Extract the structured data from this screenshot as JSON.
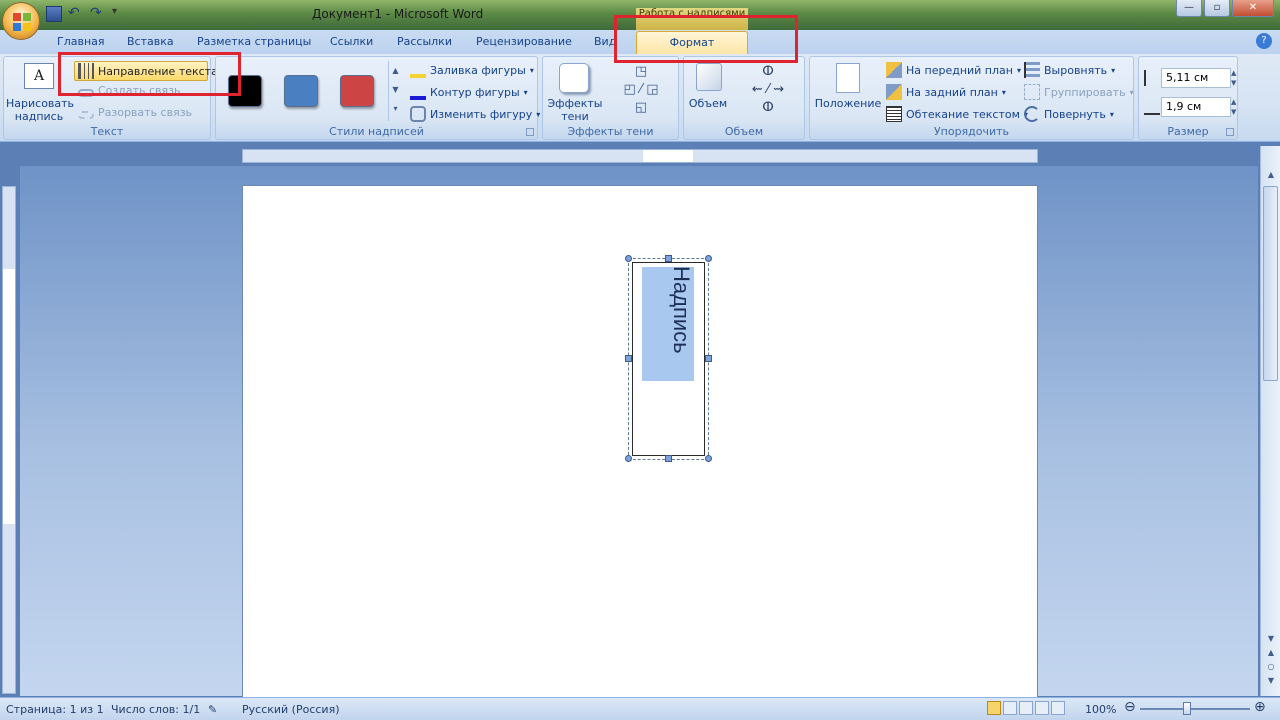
{
  "titlebar": {
    "title": "Документ1 - Microsoft Word",
    "context_tab_title": "Работа с надписями"
  },
  "tabs": [
    "Главная",
    "Вставка",
    "Разметка страницы",
    "Ссылки",
    "Рассылки",
    "Рецензирование",
    "Вид"
  ],
  "active_tab": "Формат",
  "help_label": "?",
  "ribbon": {
    "text_group": {
      "draw_label_line1": "Нарисовать",
      "draw_label_line2": "надпись",
      "text_direction": "Направление текста",
      "create_link": "Создать связь",
      "break_link": "Разорвать связь",
      "group_label": "Текст"
    },
    "styles_group": {
      "swatches": [
        "#000000",
        "#4a7fc2",
        "#cc4444"
      ],
      "fill": "Заливка фигуры",
      "outline": "Контур фигуры",
      "change_shape": "Изменить фигуру",
      "group_label": "Стили надписей"
    },
    "shadow_group": {
      "label_line1": "Эффекты",
      "label_line2": "тени",
      "group_label": "Эффекты тени"
    },
    "volume_group": {
      "label": "Объем",
      "group_label": "Объем"
    },
    "arrange_group": {
      "position": "Положение",
      "bring_front": "На передний план",
      "send_back": "На задний план",
      "wrap": "Обтекание текстом",
      "align": "Выровнять",
      "group": "Группировать",
      "rotate": "Повернуть",
      "group_label": "Упорядочить"
    },
    "size_group": {
      "height": "5,11 см",
      "width": "1,9 см",
      "group_label": "Размер"
    }
  },
  "document": {
    "textbox_text": "Надпись"
  },
  "statusbar": {
    "page": "Страница: 1 из 1",
    "words": "Число слов: 1/1",
    "language": "Русский (Россия)",
    "zoom": "100%"
  },
  "accent_colors": {
    "highlight_box": "#e0242f",
    "context_tab": "#fce5a4"
  }
}
